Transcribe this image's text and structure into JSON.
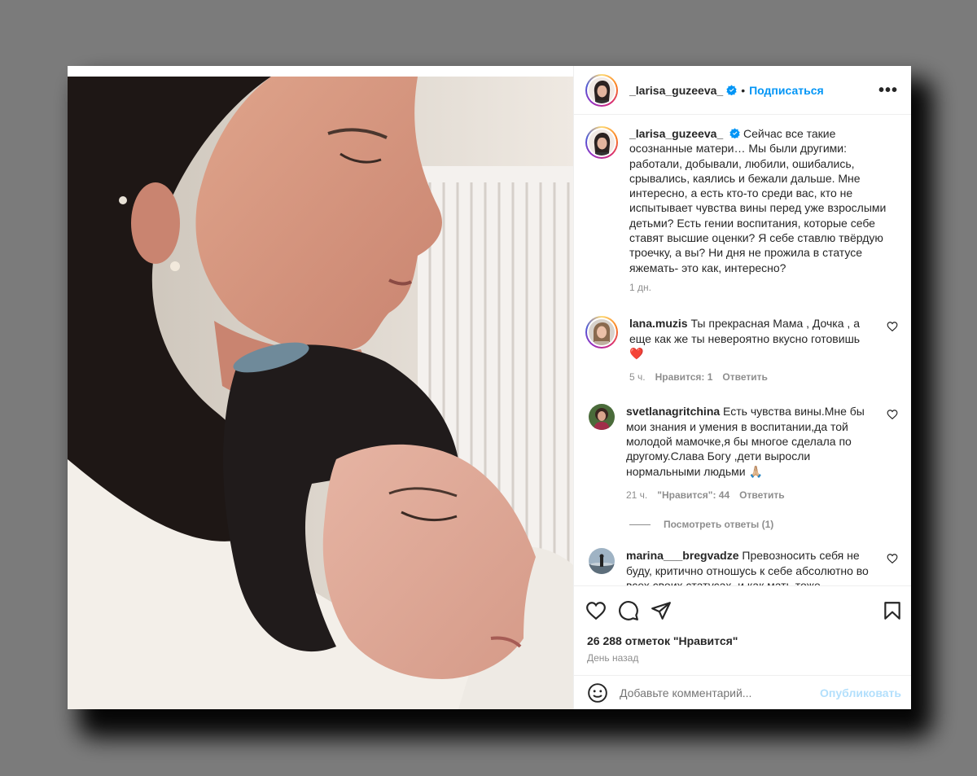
{
  "post": {
    "username": "_larisa_guzeeva_",
    "separator": "•",
    "follow_label": "Подписаться",
    "more_label": "•••"
  },
  "caption": {
    "username": "_larisa_guzeeva_",
    "text": "Сейчас все такие осознанные матери… Мы были другими: работали, добывали, любили, ошибались, срывались, каялись и бежали дальше. Мне интересно, а есть кто-то среди вас, кто не испытывает чувства вины перед уже взрослыми детьми? Есть гении воспитания, которые себе ставят высшие оценки? Я себе ставлю твёрдую троечку, а вы? Ни дня не прожила в статусе яжемать- это как, интересно?",
    "time": "1 дн."
  },
  "comments": [
    {
      "username": "lana.muzis",
      "text": "Ты прекрасная Мама , Дочка , а еще как же ты невероятно вкусно готовишь",
      "emoji": "❤️",
      "time": "5 ч.",
      "likes": "Нравится: 1",
      "reply": "Ответить"
    },
    {
      "username": "svetlanagritchina",
      "text": "Есть чувства вины.Мне бы мои знания и умения в воспитании,да той молодой мамочке,я бы многое сделала по другому.Слава Богу ,дети выросли нормальными людьми",
      "emoji": "🙏🏼",
      "time": "21 ч.",
      "likes": "\"Нравится\": 44",
      "reply": "Ответить",
      "view_replies": "Посмотреть ответы (1)"
    },
    {
      "username": "marina___bregvadze",
      "text": "Превозносить себя не буду, критично отношусь к себе абсолютно во всех своих статусах, и как мать тоже"
    }
  ],
  "footer": {
    "likes_count": "26 288 отметок \"Нравится\"",
    "date": "День назад",
    "comment_placeholder": "Добавьте комментарий...",
    "publish_label": "Опубликовать"
  },
  "colors": {
    "accent": "#0095f6",
    "publish_disabled": "#b2dffc",
    "muted": "#8e8e8e",
    "background": "#7b7b7b"
  },
  "icons": [
    "verified-badge-icon",
    "heart-icon",
    "comment-icon",
    "share-icon",
    "bookmark-icon",
    "emoji-icon"
  ]
}
